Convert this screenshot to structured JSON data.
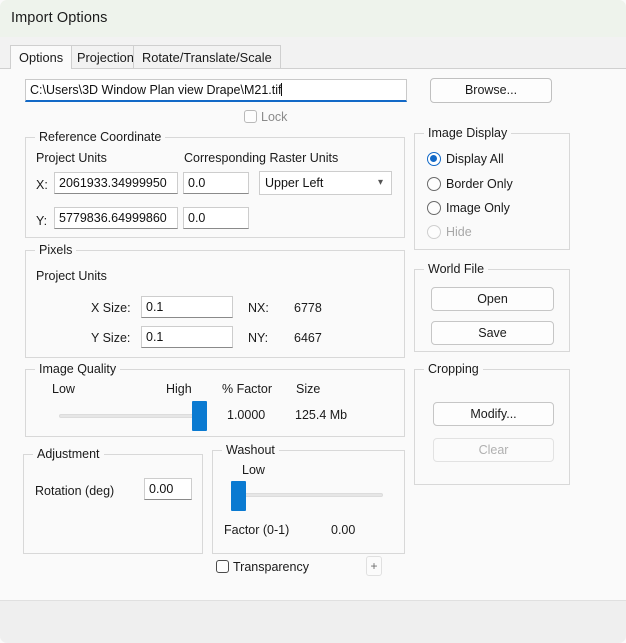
{
  "window": {
    "title": "Import Options"
  },
  "tabs": [
    {
      "label": "Options",
      "active": true
    },
    {
      "label": "Projection",
      "active": false
    },
    {
      "label": "Rotate/Translate/Scale",
      "active": false
    }
  ],
  "path_row": {
    "value": "C:\\Users\\3D Window Plan view Drape\\M21.tif",
    "browse_label": "Browse..."
  },
  "lock": {
    "label": "Lock",
    "checked": false,
    "enabled": false
  },
  "reference_coordinate": {
    "title": "Reference Coordinate",
    "project_units_label": "Project Units",
    "corresponding_raster_units_label": "Corresponding Raster Units",
    "x_label": "X:",
    "x_value": "2061933.34999950",
    "x_raster_value": "0.0",
    "y_label": "Y:",
    "y_value": "5779836.64999860",
    "y_raster_value": "0.0",
    "origin_dropdown": "Upper Left"
  },
  "pixels": {
    "title": "Pixels",
    "project_units_label": "Project Units",
    "x_size_label": "X Size:",
    "x_size_value": "0.1",
    "nx_label": "NX:",
    "nx_value": "6778",
    "y_size_label": "Y Size:",
    "y_size_value": "0.1",
    "ny_label": "NY:",
    "ny_value": "6467"
  },
  "image_quality": {
    "title": "Image Quality",
    "low_label": "Low",
    "high_label": "High",
    "percent_factor_label": "% Factor",
    "size_label": "Size",
    "percent_factor_value": "1.0000",
    "size_value": "125.4 Mb",
    "slider_position_percent": 100
  },
  "adjustment": {
    "title": "Adjustment",
    "rotation_label": "Rotation (deg)",
    "rotation_value": "0.00"
  },
  "washout": {
    "title": "Washout",
    "low_label": "Low",
    "factor_label": "Factor (0-1)",
    "factor_value": "0.00",
    "slider_position_percent": 0
  },
  "image_display": {
    "title": "Image Display",
    "options": [
      {
        "label": "Display All",
        "selected": true,
        "enabled": true
      },
      {
        "label": "Border Only",
        "selected": false,
        "enabled": true
      },
      {
        "label": "Image Only",
        "selected": false,
        "enabled": true
      },
      {
        "label": "Hide",
        "selected": false,
        "enabled": false
      }
    ]
  },
  "world_file": {
    "title": "World File",
    "open_label": "Open",
    "save_label": "Save"
  },
  "cropping": {
    "title": "Cropping",
    "modify_label": "Modify...",
    "clear_label": "Clear",
    "clear_enabled": false
  },
  "transparency": {
    "label": "Transparency",
    "checked": false,
    "plus_label": "+"
  },
  "colors": {
    "accent": "#1269c7",
    "slider_thumb": "#0a7ad1",
    "titlebar_bg": "#eef3ec"
  }
}
